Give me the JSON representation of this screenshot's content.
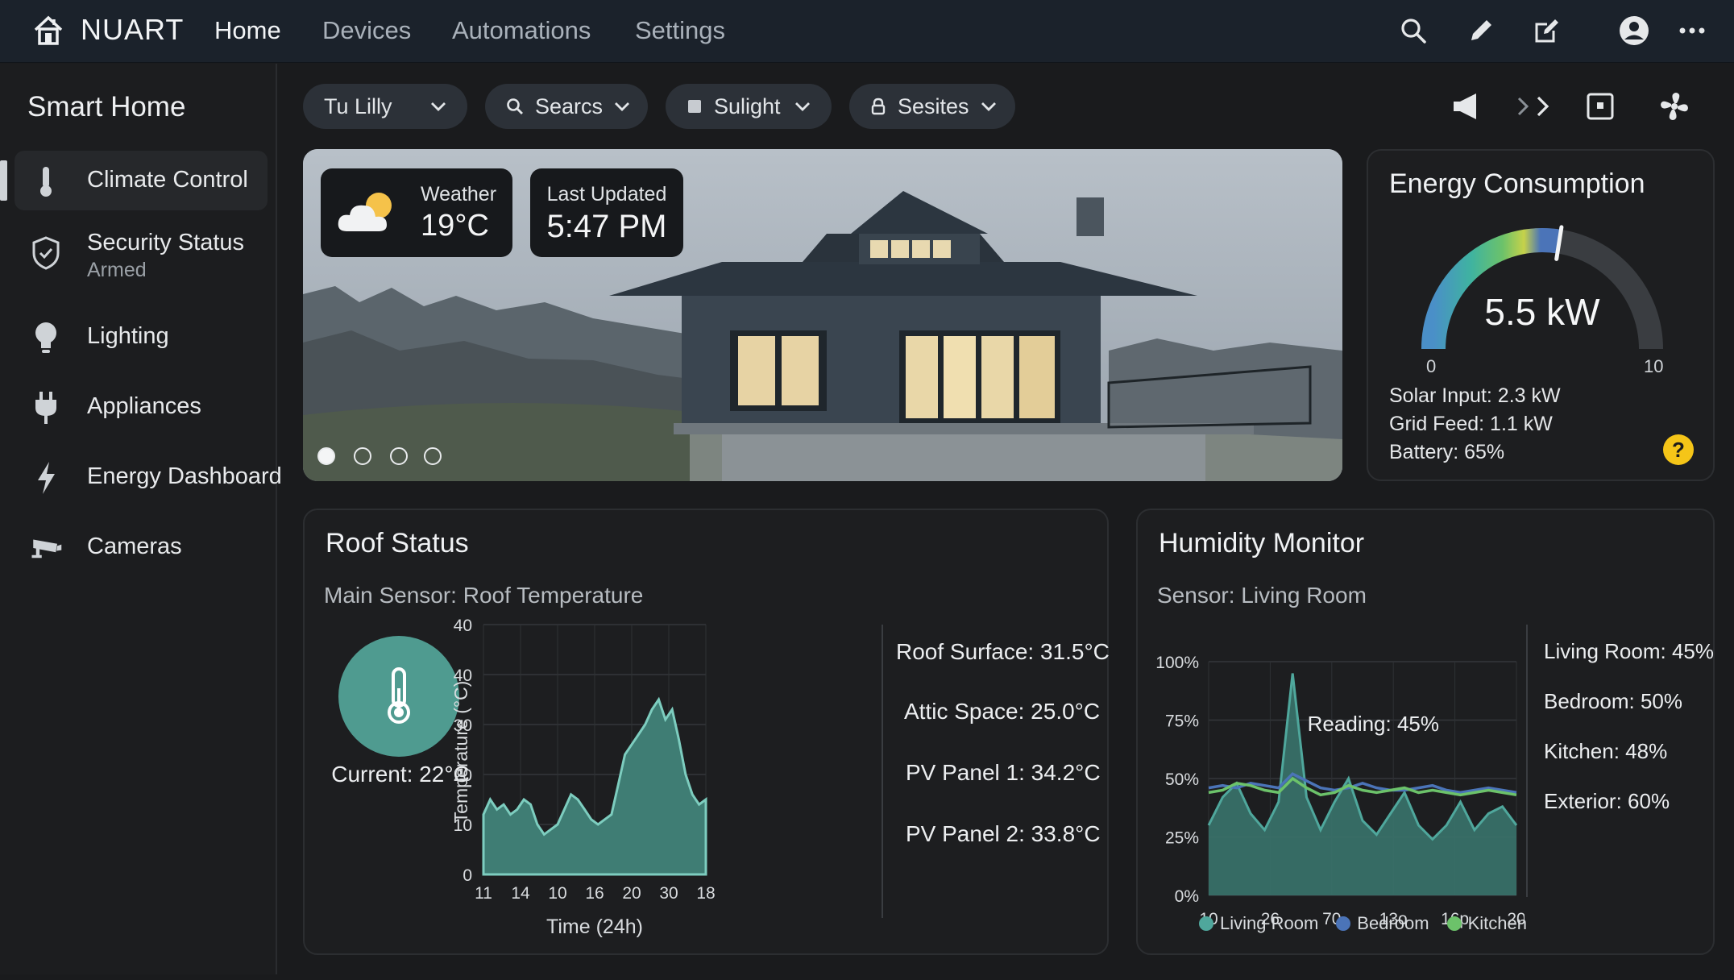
{
  "app": {
    "brand": "NUART",
    "nav": [
      "Home",
      "Devices",
      "Automations",
      "Settings"
    ],
    "active_nav": "Home",
    "top_icons": [
      "search-icon",
      "pencil-icon",
      "edit-square-icon",
      "account-icon",
      "more-icon"
    ]
  },
  "sidebar": {
    "title": "Smart Home",
    "items": [
      {
        "label": "Climate Control",
        "icon": "thermometer-icon",
        "active": true
      },
      {
        "label": "Security Status",
        "sub": "Armed",
        "icon": "shield-check-icon"
      },
      {
        "label": "Lighting",
        "icon": "bulb-icon"
      },
      {
        "label": "Appliances",
        "icon": "plug-icon"
      },
      {
        "label": "Energy Dashboard",
        "icon": "bolt-icon"
      },
      {
        "label": "Cameras",
        "icon": "camera-icon"
      }
    ]
  },
  "filters": [
    {
      "label": "Tu Lilly",
      "icon": ""
    },
    {
      "label": "Searcs",
      "icon": "search-icon"
    },
    {
      "label": "Sulight",
      "icon": "square-icon"
    },
    {
      "label": "Sesites",
      "icon": "lock-icon"
    }
  ],
  "toolbar_icons": [
    "speaker-icon",
    "forward-icon",
    "window-icon",
    "fan-icon"
  ],
  "hero": {
    "weather_label": "Weather",
    "weather_value": "19°C",
    "updated_label": "Last Updated",
    "updated_value": "5:47 PM",
    "slides": 4,
    "active_slide": 0
  },
  "energy": {
    "title": "Energy Consumption",
    "value": "5.5 kW",
    "gauge_value": 5.5,
    "gauge_min": "0",
    "gauge_max": "10",
    "solar": "Solar Input: 2.3 kW",
    "grid": "Grid Feed: 1.1 kW",
    "battery": "Battery: 65%",
    "help": "?"
  },
  "roof": {
    "title": "Roof Status",
    "subtitle": "Main Sensor: Roof Temperature",
    "current": "Current: 22°C",
    "readings": [
      "Roof Surface: 31.5°C",
      "Attic Space: 25.0°C",
      "PV Panel 1: 34.2°C",
      "PV Panel 2: 33.8°C"
    ],
    "chart_data": {
      "type": "area",
      "xlabel": "Time (24h)",
      "ylabel": "Temperature (°C)",
      "ytick_labels": [
        "40",
        "40",
        "30",
        "20",
        "10",
        "0"
      ],
      "xtick_labels": [
        "11",
        "14",
        "10",
        "16",
        "20",
        "30",
        "18"
      ],
      "ylim": [
        0,
        50
      ],
      "grid": true,
      "values": [
        12,
        15,
        13,
        14,
        12,
        13,
        15,
        14,
        10,
        8,
        9,
        10,
        13,
        16,
        15,
        13,
        11,
        10,
        11,
        12,
        18,
        24,
        26,
        28,
        30,
        33,
        35,
        31,
        33,
        27,
        20,
        16,
        14,
        15
      ]
    }
  },
  "humidity": {
    "title": "Humidity Monitor",
    "subtitle": "Sensor: Living Room",
    "reading": "Reading: 45%",
    "stats": [
      "Living Room: 45%",
      "Bedroom: 50%",
      "Kitchen: 48%",
      "Exterior: 60%"
    ],
    "chart_data": {
      "type": "area",
      "ytick_labels": [
        "100%",
        "75%",
        "50%",
        "25%",
        "0%"
      ],
      "xtick_labels": [
        "10",
        "26",
        "70",
        "13o",
        "16p",
        "20"
      ],
      "ylim": [
        0,
        100
      ],
      "grid": true,
      "series": [
        {
          "name": "Living Room",
          "color": "#4fa79c",
          "values": [
            30,
            42,
            48,
            35,
            28,
            40,
            95,
            42,
            28,
            40,
            50,
            32,
            26,
            35,
            44,
            30,
            24,
            30,
            40,
            28,
            35,
            38,
            30
          ]
        },
        {
          "name": "Bedroom",
          "color": "#4b74b8",
          "values": [
            46,
            47,
            46,
            48,
            47,
            46,
            52,
            49,
            46,
            45,
            46,
            48,
            46,
            45,
            45,
            46,
            47,
            45,
            44,
            45,
            46,
            45,
            44
          ]
        },
        {
          "name": "Kitchen",
          "color": "#6cc26a",
          "values": [
            44,
            45,
            48,
            47,
            45,
            44,
            50,
            46,
            43,
            44,
            47,
            45,
            44,
            45,
            46,
            44,
            45,
            44,
            43,
            44,
            45,
            44,
            43
          ]
        }
      ]
    }
  }
}
